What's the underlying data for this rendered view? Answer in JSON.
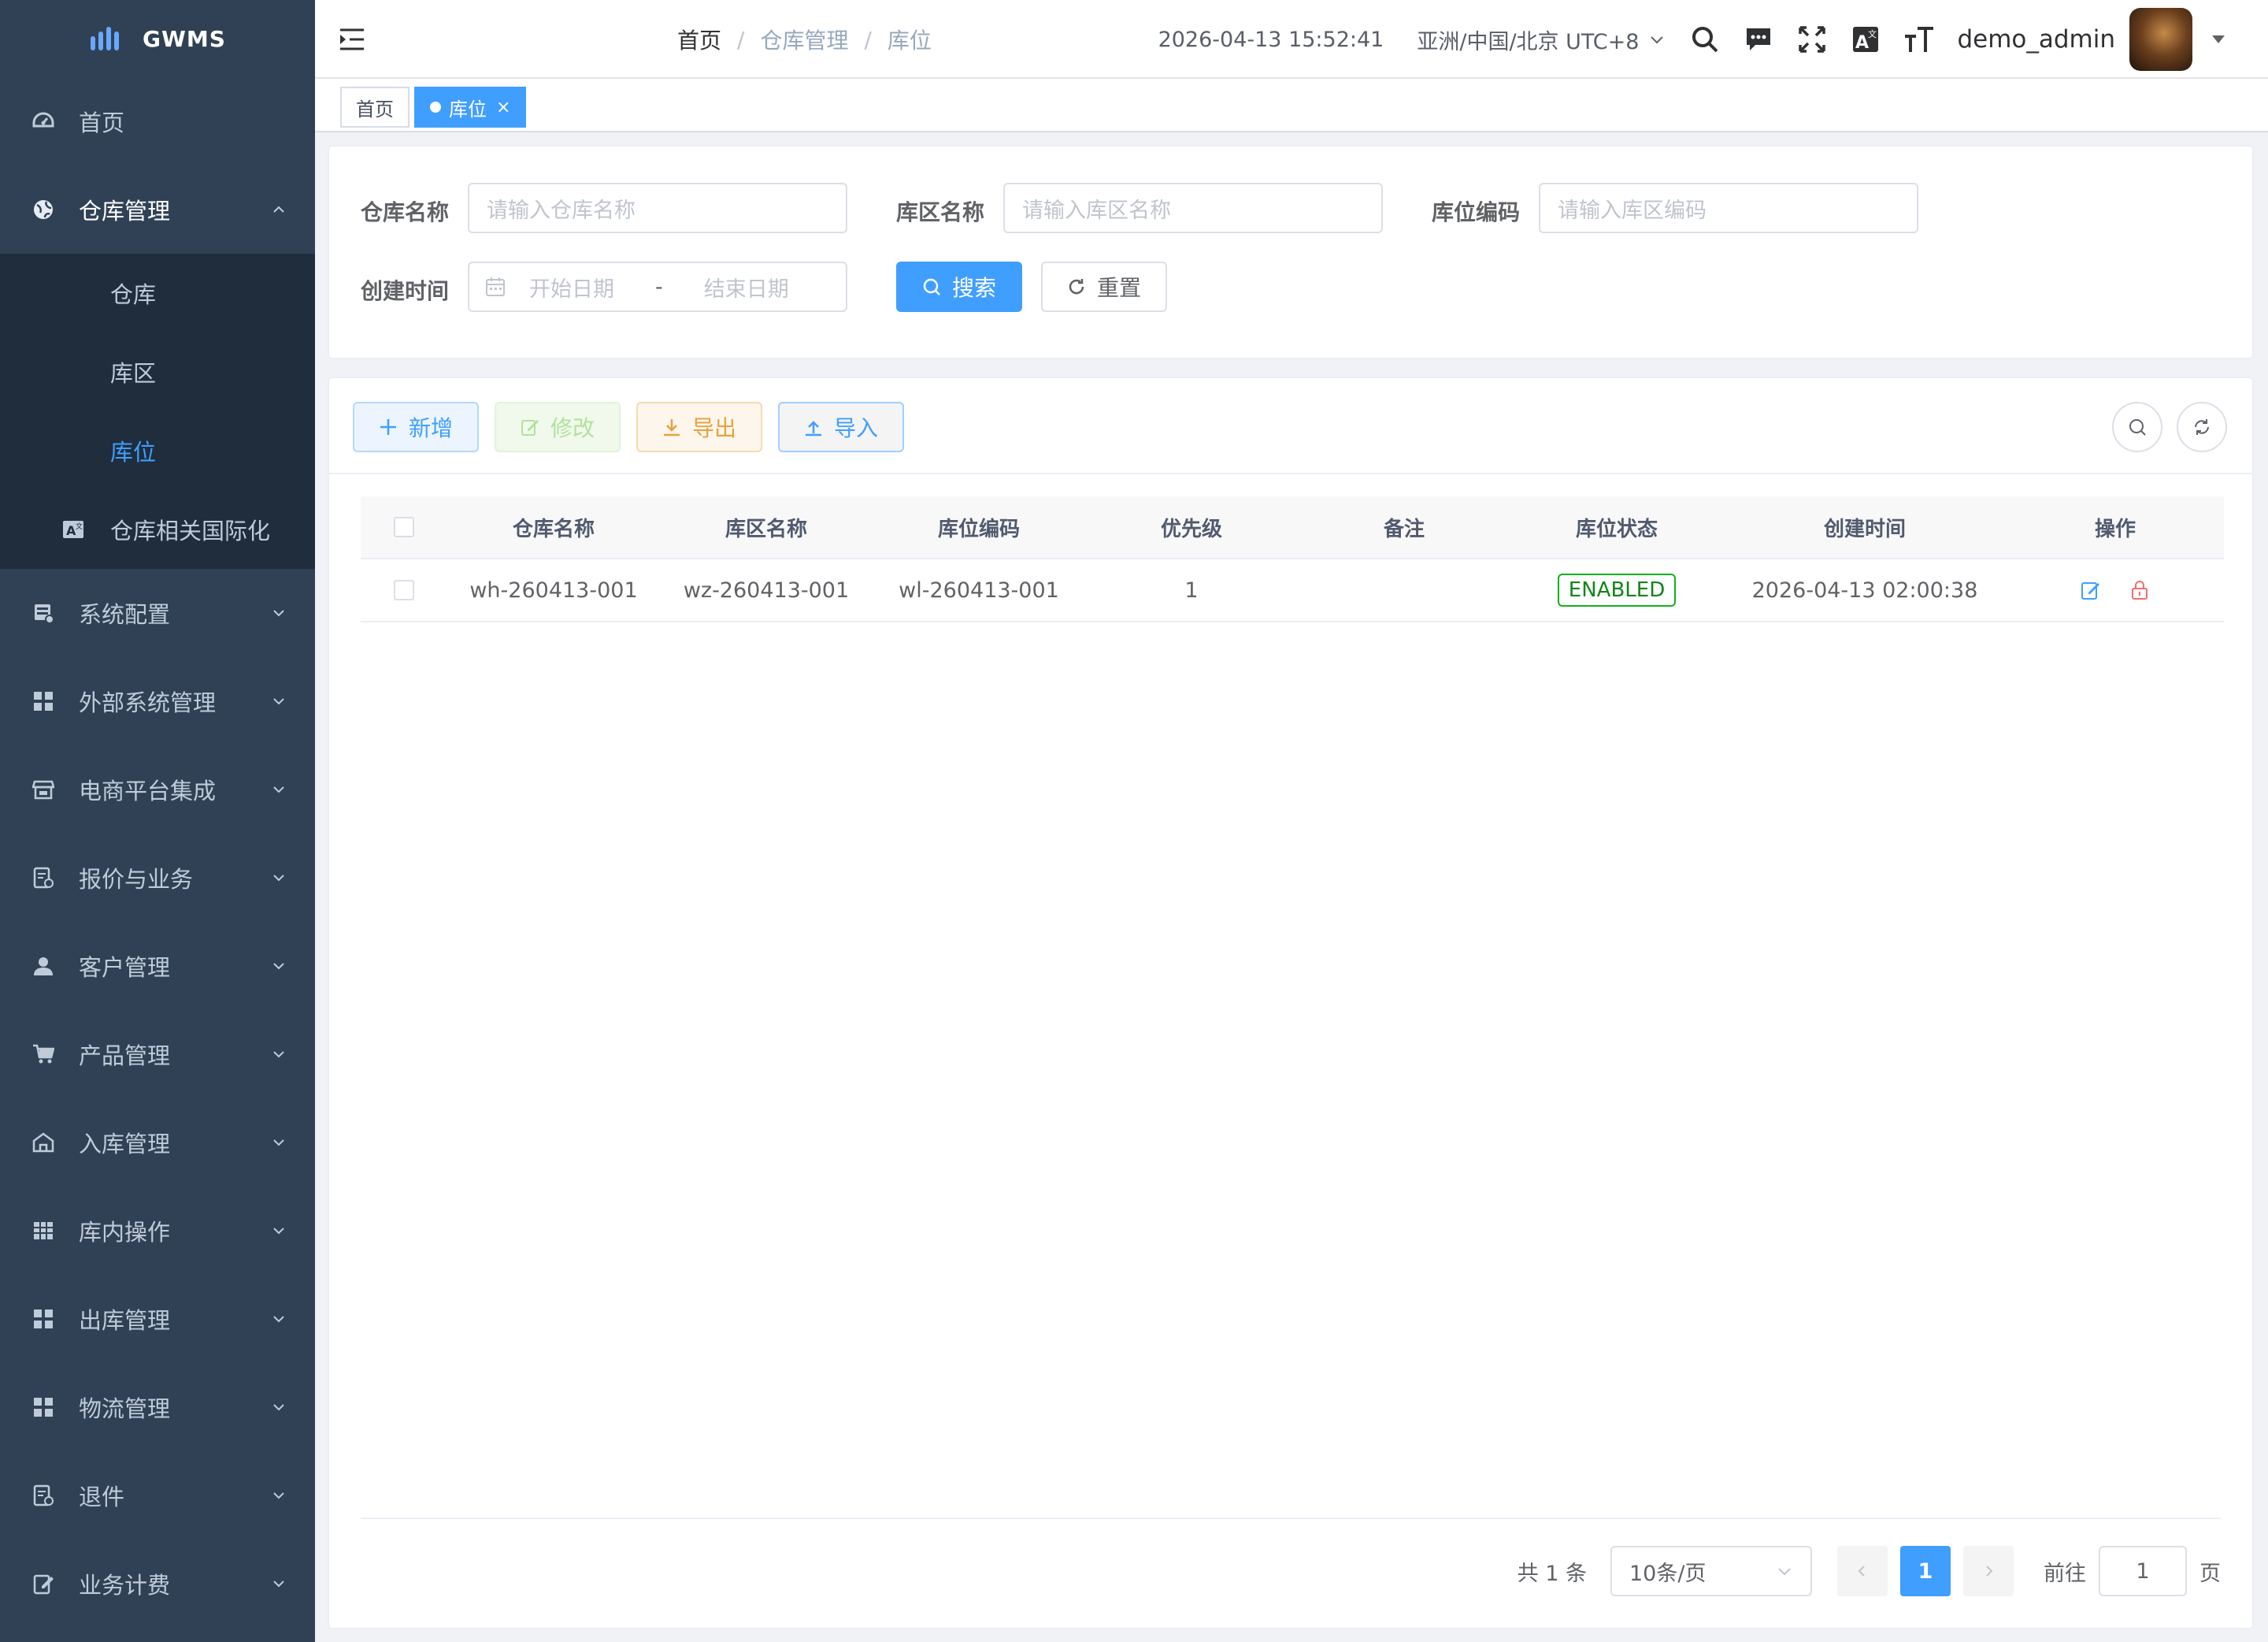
{
  "app": {
    "logo_text": "GWMS"
  },
  "sidebar": {
    "items": [
      {
        "label": "首页",
        "icon": "dashboard-icon"
      },
      {
        "label": "仓库管理",
        "icon": "globe-icon",
        "expanded": true,
        "children": [
          {
            "label": "仓库"
          },
          {
            "label": "库区"
          },
          {
            "label": "库位",
            "active": true
          },
          {
            "label": "仓库相关国际化",
            "icon": "translate-icon"
          }
        ]
      },
      {
        "label": "系统配置",
        "icon": "server-icon"
      },
      {
        "label": "外部系统管理",
        "icon": "grid-icon"
      },
      {
        "label": "电商平台集成",
        "icon": "store-icon"
      },
      {
        "label": "报价与业务",
        "icon": "document-icon"
      },
      {
        "label": "客户管理",
        "icon": "user-icon"
      },
      {
        "label": "产品管理",
        "icon": "cart-icon"
      },
      {
        "label": "入库管理",
        "icon": "warehouse-in-icon"
      },
      {
        "label": "库内操作",
        "icon": "table-icon"
      },
      {
        "label": "出库管理",
        "icon": "grid-icon"
      },
      {
        "label": "物流管理",
        "icon": "grid-icon"
      },
      {
        "label": "退件",
        "icon": "document-icon"
      },
      {
        "label": "业务计费",
        "icon": "edit-doc-icon"
      }
    ]
  },
  "header": {
    "breadcrumb": [
      "首页",
      "仓库管理",
      "库位"
    ],
    "breadcrumb_sep": "/",
    "datetime": "2026-04-13 15:52:41",
    "timezone": "亚洲/中国/北京 UTC+8",
    "username": "demo_admin"
  },
  "tags": [
    {
      "label": "首页",
      "active": false
    },
    {
      "label": "库位",
      "active": true,
      "close": "×"
    }
  ],
  "search": {
    "fields": [
      {
        "label": "仓库名称",
        "placeholder": "请输入仓库名称"
      },
      {
        "label": "库区名称",
        "placeholder": "请输入库区名称"
      },
      {
        "label": "库位编码",
        "placeholder": "请输入库区编码"
      }
    ],
    "date_label": "创建时间",
    "date_start_placeholder": "开始日期",
    "date_sep": "-",
    "date_end_placeholder": "结束日期",
    "search_button": "搜索",
    "reset_button": "重置"
  },
  "toolbar": {
    "add": "新增",
    "edit": "修改",
    "export": "导出",
    "import": "导入"
  },
  "table": {
    "columns": [
      "仓库名称",
      "库区名称",
      "库位编码",
      "优先级",
      "备注",
      "库位状态",
      "创建时间",
      "操作"
    ],
    "rows": [
      {
        "warehouse": "wh-260413-001",
        "zone": "wz-260413-001",
        "location": "wl-260413-001",
        "priority": "1",
        "remark": "",
        "status": "ENABLED",
        "created": "2026-04-13 02:00:38"
      }
    ]
  },
  "pagination": {
    "total": "共 1 条",
    "page_size": "10条/页",
    "current_page": "1",
    "goto_label": "前往",
    "goto_value": "1",
    "page_suffix": "页"
  },
  "colors": {
    "sidebar_bg": "#304156",
    "submenu_bg": "#1f2d3d",
    "primary": "#409eff",
    "status_green": "#13b01d"
  }
}
